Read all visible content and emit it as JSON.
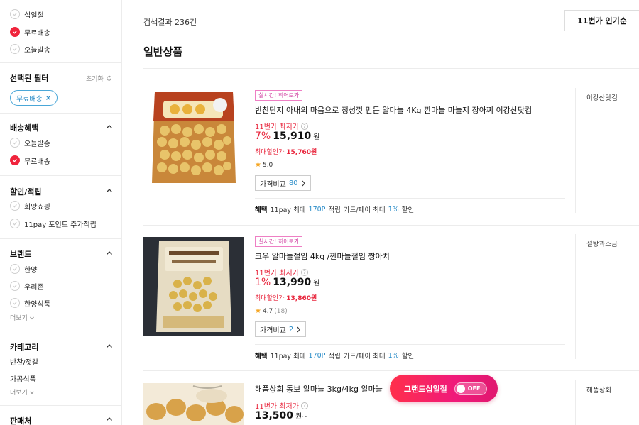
{
  "sidebar": {
    "top_options": [
      {
        "label": "십일절",
        "checked": false
      },
      {
        "label": "무료배송",
        "checked": true
      },
      {
        "label": "오늘발송",
        "checked": false
      }
    ],
    "selected_filters": {
      "title": "선택된 필터",
      "reset_label": "초기화",
      "chips": [
        "무료배송"
      ]
    },
    "delivery": {
      "title": "배송혜택",
      "options": [
        {
          "label": "오늘발송",
          "checked": false
        },
        {
          "label": "무료배송",
          "checked": true
        }
      ]
    },
    "discount": {
      "title": "할인/적립",
      "options": [
        {
          "label": "희망쇼핑",
          "checked": false
        },
        {
          "label": "11pay 포인트 추가적립",
          "checked": false
        }
      ]
    },
    "brand": {
      "title": "브랜드",
      "options": [
        {
          "label": "한양",
          "checked": false
        },
        {
          "label": "우리존",
          "checked": false
        },
        {
          "label": "한양식품",
          "checked": false
        }
      ],
      "more_label": "더보기"
    },
    "category": {
      "title": "카테고리",
      "items": [
        "반찬/젓갈",
        "가공식품"
      ],
      "more_label": "더보기"
    },
    "seller": {
      "title": "판매처"
    }
  },
  "main": {
    "result_count": "검색결과 236건",
    "sort_label": "11번가 인기순",
    "section_title": "일반상품"
  },
  "products": [
    {
      "badge": "실시간! 히어로가",
      "title": "반찬단지 아내의 마음으로 정성껏 만든 알마늘 4Kg 깐마늘 마늘지 장아찌 이강산닷컴",
      "lowest_label": "11번가 최저가",
      "discount": "7%",
      "price": "15,910",
      "won": "원",
      "max_discount_label": "최대할인가",
      "max_discount_price": "15,760원",
      "rating": "5.0",
      "review_count": "",
      "compare_label": "가격비교",
      "compare_count": "80",
      "benefit_title": "혜택",
      "benefit_pay_prefix": "11pay 최대",
      "benefit_points": "170P",
      "benefit_pay_suffix": "적립",
      "benefit_card_prefix": "카드/페이 최대",
      "benefit_card_rate": "1%",
      "benefit_card_suffix": "할인",
      "seller": "이강산닷컴"
    },
    {
      "badge": "실시간! 히어로가",
      "title": "코우 알마늘절임 4kg /깐마늘절임 짱아치",
      "lowest_label": "11번가 최저가",
      "discount": "1%",
      "price": "13,990",
      "won": "원",
      "max_discount_label": "최대할인가",
      "max_discount_price": "13,860원",
      "rating": "4.7",
      "review_count": "(18)",
      "compare_label": "가격비교",
      "compare_count": "2",
      "benefit_title": "혜택",
      "benefit_pay_prefix": "11pay 최대",
      "benefit_points": "170P",
      "benefit_pay_suffix": "적립",
      "benefit_card_prefix": "카드/페이 최대",
      "benefit_card_rate": "1%",
      "benefit_card_suffix": "할인",
      "seller": "설탕과소금"
    },
    {
      "title": "해품상회 동보 알마늘 3kg/4kg 알마늘",
      "lowest_label": "11번가 최저가",
      "price": "13,500",
      "won": "원~",
      "seller": "해품상회"
    }
  ],
  "grand_sale": {
    "label": "그랜드십일절",
    "toggle_state": "OFF"
  },
  "colors": {
    "accent_red": "#e8243b",
    "link_blue": "#2b8dc8",
    "badge_pink": "#d03fa0"
  }
}
